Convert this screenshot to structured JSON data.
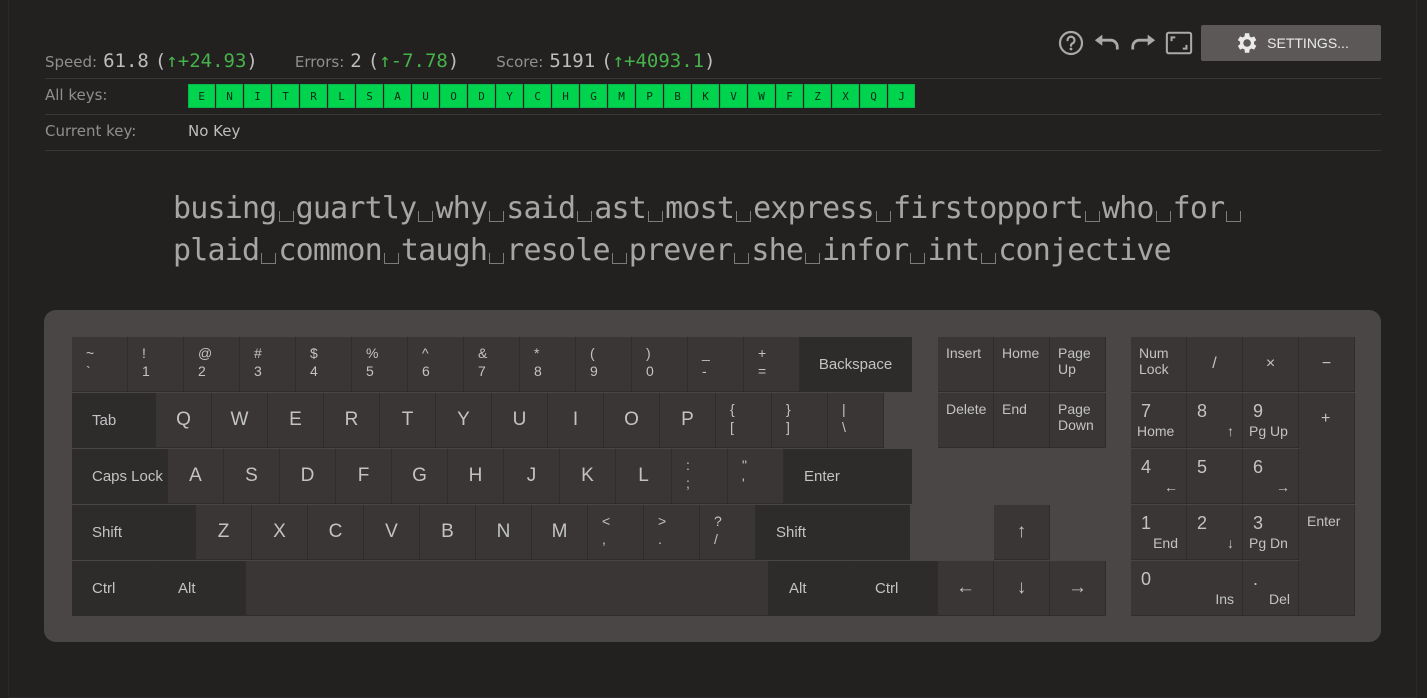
{
  "stats": {
    "speed": {
      "label": "Speed:",
      "value": "61.8",
      "delta": "+24.93"
    },
    "errors": {
      "label": "Errors:",
      "value": "2",
      "delta": "-7.78"
    },
    "score": {
      "label": "Score:",
      "value": "5191",
      "delta": "+4093.1"
    }
  },
  "toolbar": {
    "help_icon": "help-icon",
    "undo_icon": "undo-icon",
    "redo_icon": "redo-icon",
    "fullscreen_icon": "fullscreen-icon",
    "settings_label": "SETTINGS..."
  },
  "all_keys": {
    "label": "All keys:",
    "keys": [
      "E",
      "N",
      "I",
      "T",
      "R",
      "L",
      "S",
      "A",
      "U",
      "O",
      "D",
      "Y",
      "C",
      "H",
      "G",
      "M",
      "P",
      "B",
      "K",
      "V",
      "W",
      "F",
      "Z",
      "X",
      "Q",
      "J"
    ],
    "color": "#00d44f"
  },
  "current_key": {
    "label": "Current key:",
    "value": "No Key"
  },
  "practice": {
    "lines": [
      [
        "busing",
        "guartly",
        "why",
        "said",
        "ast",
        "most",
        "express",
        "firstopport",
        "who",
        "for",
        ""
      ],
      [
        "plaid",
        "common",
        "taugh",
        "resole",
        "prever",
        "she",
        "infor",
        "int",
        "conjective"
      ]
    ]
  },
  "keyboard": {
    "row1": [
      [
        "~",
        "`"
      ],
      [
        "!",
        "1"
      ],
      [
        "@",
        "2"
      ],
      [
        "#",
        "3"
      ],
      [
        "$",
        "4"
      ],
      [
        "%",
        "5"
      ],
      [
        "^",
        "6"
      ],
      [
        "&",
        "7"
      ],
      [
        "*",
        "8"
      ],
      [
        "(",
        "9"
      ],
      [
        ")",
        "0"
      ],
      [
        "_",
        "-"
      ],
      [
        "+",
        "="
      ]
    ],
    "backspace": "Backspace",
    "tab": "Tab",
    "row2": [
      "Q",
      "W",
      "E",
      "R",
      "T",
      "Y",
      "U",
      "I",
      "O",
      "P"
    ],
    "row2_sym": [
      [
        "{",
        "["
      ],
      [
        "}",
        "]"
      ],
      [
        "|",
        "\\"
      ]
    ],
    "caps": "Caps Lock",
    "row3": [
      "A",
      "S",
      "D",
      "F",
      "G",
      "H",
      "J",
      "K",
      "L"
    ],
    "row3_sym": [
      [
        ":",
        ";"
      ],
      [
        "\"",
        "'"
      ]
    ],
    "enter": "Enter",
    "shift_left": "Shift",
    "row4": [
      "Z",
      "X",
      "C",
      "V",
      "B",
      "N",
      "M"
    ],
    "row4_sym": [
      [
        "<",
        ","
      ],
      [
        ">",
        "."
      ],
      [
        "?",
        "/"
      ]
    ],
    "shift_right": "Shift",
    "ctrl_left": "Ctrl",
    "alt_left": "Alt",
    "alt_right": "Alt",
    "ctrl_right": "Ctrl",
    "nav": {
      "insert": "Insert",
      "home": "Home",
      "page_up": "Page\nUp",
      "delete": "Delete",
      "end": "End",
      "page_down": "Page\nDown"
    },
    "arrows": {
      "up": "↑",
      "left": "←",
      "down": "↓",
      "right": "→"
    },
    "numpad": {
      "numlock": "Num\nLock",
      "div": "/",
      "mul": "×",
      "minus": "−",
      "plus": "+",
      "enter": "Enter",
      "n7": "7",
      "n7s": "Home",
      "n8": "8",
      "n8s": "↑",
      "n9": "9",
      "n9s": "Pg Up",
      "n4": "4",
      "n4s": "←",
      "n5": "5",
      "n6": "6",
      "n6s": "→",
      "n1": "1",
      "n1s": "End",
      "n2": "2",
      "n2s": "↓",
      "n3": "3",
      "n3s": "Pg Dn",
      "n0": "0",
      "n0s": "Ins",
      "dot": ".",
      "dots": "Del"
    }
  }
}
